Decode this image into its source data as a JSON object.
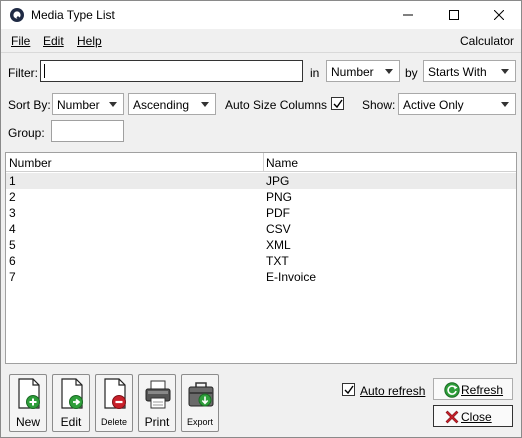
{
  "window": {
    "title": "Media Type List"
  },
  "menu": {
    "file": "File",
    "edit": "Edit",
    "help": "Help",
    "calculator": "Calculator"
  },
  "filter": {
    "label": "Filter:",
    "value": "",
    "in_label": "in",
    "field": "Number",
    "by_label": "by",
    "mode": "Starts With"
  },
  "sort": {
    "label": "Sort By:",
    "field": "Number",
    "order": "Ascending",
    "auto_size_label": "Auto Size Columns",
    "auto_size_checked": true,
    "show_label": "Show:",
    "show": "Active Only"
  },
  "group": {
    "label": "Group:",
    "value": ""
  },
  "table": {
    "columns": [
      "Number",
      "Name"
    ],
    "rows": [
      [
        "1",
        "JPG"
      ],
      [
        "2",
        "PNG"
      ],
      [
        "3",
        "PDF"
      ],
      [
        "4",
        "CSV"
      ],
      [
        "5",
        "XML"
      ],
      [
        "6",
        "TXT"
      ],
      [
        "7",
        "E-Invoice"
      ]
    ],
    "selected_row": 0
  },
  "toolbar": {
    "new": "New",
    "edit": "Edit",
    "delete": "Delete",
    "print": "Print",
    "export": "Export"
  },
  "auto_refresh": {
    "label": "Auto refresh",
    "checked": true
  },
  "buttons": {
    "refresh": "Refresh",
    "close": "Close"
  },
  "colors": {
    "add_green": "#2e9e3a",
    "delete_red": "#c8202a",
    "selection": "#ebebeb"
  }
}
